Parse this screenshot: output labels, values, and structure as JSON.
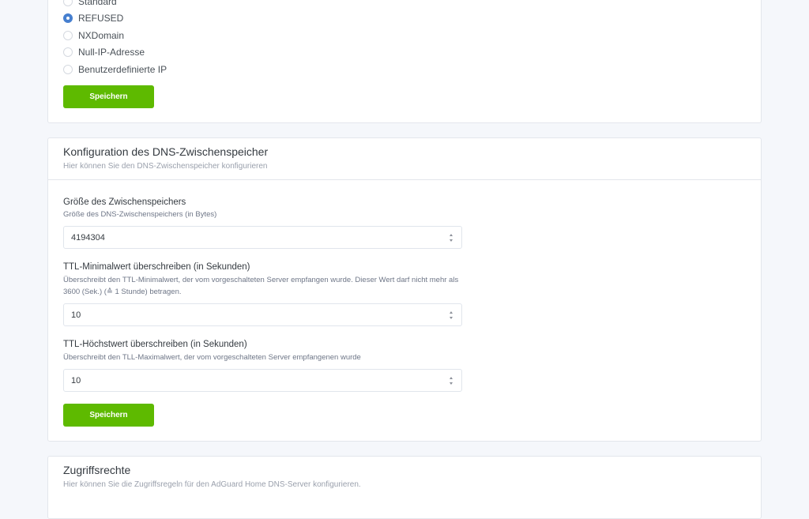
{
  "blocking_mode": {
    "options": [
      {
        "label": "Standard",
        "checked": false
      },
      {
        "label": "REFUSED",
        "checked": true
      },
      {
        "label": "NXDomain",
        "checked": false
      },
      {
        "label": "Null-IP-Adresse",
        "checked": false
      },
      {
        "label": "Benutzerdefinierte IP",
        "checked": false
      }
    ],
    "save_label": "Speichern"
  },
  "cache_config": {
    "title": "Konfiguration des DNS-Zwischenspeicher",
    "subtitle": "Hier können Sie den DNS-Zwischenspeicher konfigurieren",
    "cache_size": {
      "label": "Größe des Zwischenspeichers",
      "description": "Größe des DNS-Zwischenspeichers (in Bytes)",
      "value": "4194304"
    },
    "ttl_min": {
      "label": "TTL-Minimalwert überschreiben (in Sekunden)",
      "description": "Überschreibt den TTL-Minimalwert, der vom vorgeschalteten Server empfangen wurde. Dieser Wert darf nicht mehr als 3600 (Sek.) (≙ 1 Stunde) betragen.",
      "value": "10"
    },
    "ttl_max": {
      "label": "TTL-Höchstwert überschreiben (in Sekunden)",
      "description": "Überschreibt den TLL-Maximalwert, der vom vorgeschalteten Server empfangenen wurde",
      "value": "10"
    },
    "save_label": "Speichern"
  },
  "access": {
    "title": "Zugriffsrechte",
    "subtitle": "Hier können Sie die Zugriffsregeln für den AdGuard Home DNS-Server konfigurieren."
  },
  "colors": {
    "accent_green": "#5eba00",
    "radio_checked": "#467fcf",
    "page_bg": "#f5f7fb"
  }
}
